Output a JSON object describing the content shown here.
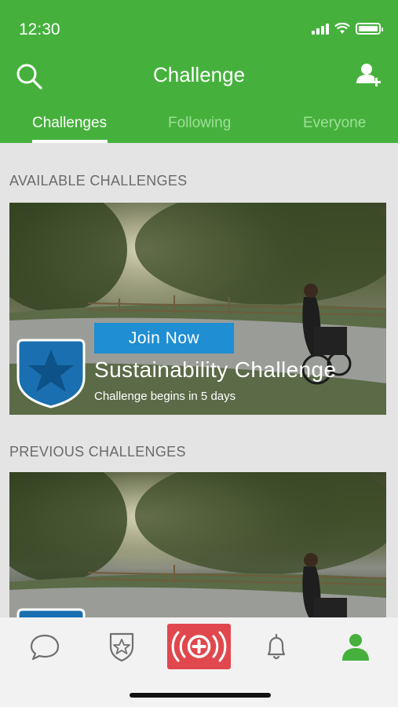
{
  "status_bar": {
    "time": "12:30"
  },
  "header": {
    "title": "Challenge",
    "search_icon": "search-icon",
    "add_user_icon": "add-user-icon"
  },
  "tabs": [
    {
      "label": "Challenges",
      "active": true
    },
    {
      "label": "Following",
      "active": false
    },
    {
      "label": "Everyone",
      "active": false
    }
  ],
  "available": {
    "label": "AVAILABLE CHALLENGES",
    "card": {
      "join_label": "Join Now",
      "title": "Sustainability Challenge",
      "subtitle": "Challenge begins in 5 days",
      "badge_icon": "star-shield-icon"
    }
  },
  "previous": {
    "label": "PREVIOUS CHALLENGES"
  },
  "bottom_nav": [
    {
      "icon": "chat-bubble-icon"
    },
    {
      "icon": "star-shield-icon"
    },
    {
      "icon": "emergency-plus-icon"
    },
    {
      "icon": "bell-icon"
    },
    {
      "icon": "profile-icon",
      "active": true
    }
  ],
  "colors": {
    "brand_green": "#45b13c",
    "join_blue": "#1f8ed3",
    "badge_blue": "#1a6fb0",
    "emergency_red": "#e0484e"
  }
}
